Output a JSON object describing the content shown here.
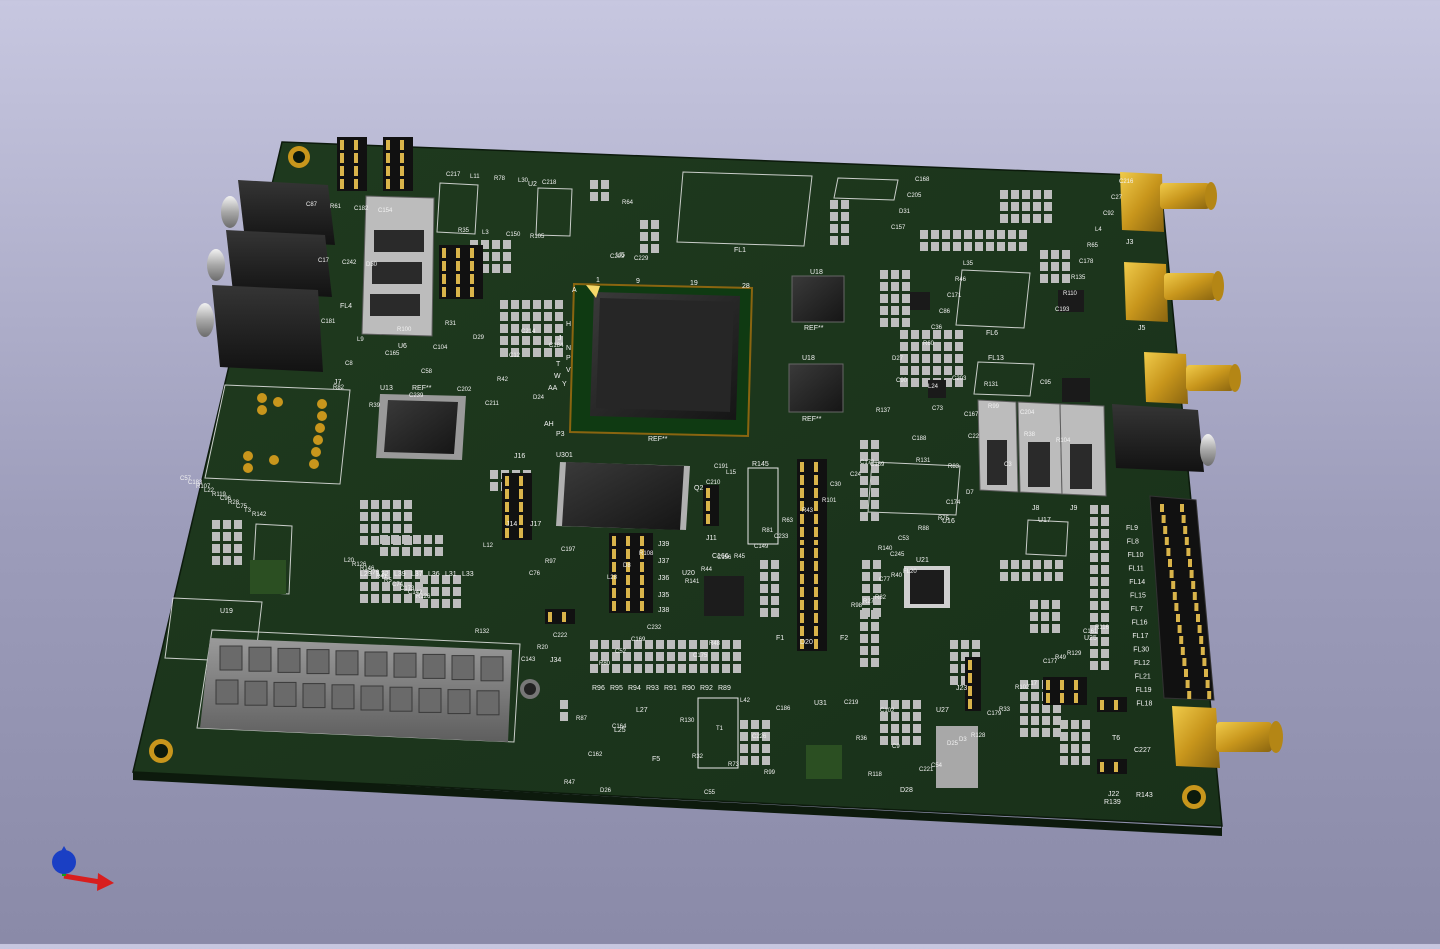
{
  "viewer": {
    "axes_indicator": "xyz-axes-icon"
  },
  "board": {
    "components": {
      "main_fpga": {
        "designator": "REF**",
        "pin_labels": [
          "1",
          "9",
          "19",
          "28",
          "A",
          "H",
          "J",
          "N",
          "P",
          "T",
          "V",
          "W",
          "Y",
          "AA",
          "AH",
          "P3"
        ]
      },
      "u18_top": {
        "designator": "U18",
        "ref": "REF**"
      },
      "u18_bottom": {
        "designator": "U18",
        "ref": "REF**"
      },
      "u13": {
        "designator": "U13",
        "ref": "REF**"
      },
      "u301": {
        "designator": "U301"
      },
      "u19": {
        "designator": "U19"
      },
      "u16": {
        "designator": "U16"
      },
      "u17": {
        "designator": "U17"
      },
      "u20": {
        "designator": "U20"
      },
      "u21": {
        "designator": "U21"
      },
      "u25": {
        "designator": "U25"
      },
      "u27": {
        "designator": "U27"
      },
      "u31": {
        "designator": "U31"
      },
      "u5": {
        "designator": "U5"
      },
      "u6": {
        "designator": "U6"
      },
      "u2": {
        "designator": "U2"
      },
      "fl1": {
        "designator": "FL1"
      },
      "fl4": {
        "designator": "FL4"
      },
      "fl6": {
        "designator": "FL6"
      },
      "fl13": {
        "designator": "FL13"
      },
      "j3": {
        "designator": "J3"
      },
      "j5": {
        "designator": "J5"
      },
      "j7": {
        "designator": "J7"
      },
      "j8": {
        "designator": "J8"
      },
      "j9": {
        "designator": "J9"
      },
      "j11": {
        "designator": "J11"
      },
      "j14": {
        "designator": "J14"
      },
      "j16": {
        "designator": "J16"
      },
      "j17": {
        "designator": "J17"
      },
      "j22": {
        "designator": "J22"
      },
      "j23": {
        "designator": "J23"
      },
      "j34": {
        "designator": "J34"
      },
      "j35": {
        "designator": "J35"
      },
      "j36": {
        "designator": "J36"
      },
      "j37": {
        "designator": "J37"
      },
      "j38": {
        "designator": "J38"
      },
      "j39": {
        "designator": "J39"
      },
      "t6": {
        "designator": "T6"
      },
      "f1": {
        "designator": "F1"
      },
      "f2": {
        "designator": "F2"
      },
      "f5": {
        "designator": "F5"
      },
      "l25": {
        "designator": "L25"
      },
      "l27": {
        "designator": "L27"
      },
      "r145": {
        "designator": "R145"
      },
      "c166": {
        "designator": "C166"
      },
      "q2": {
        "designator": "Q2"
      },
      "d20": {
        "designator": "D20"
      },
      "d28": {
        "designator": "D28"
      },
      "r139": {
        "designator": "R139"
      },
      "r143": {
        "designator": "R143"
      },
      "c227": {
        "designator": "C227"
      }
    },
    "fl_column": [
      "FL9",
      "FL8",
      "FL10",
      "FL11",
      "FL14",
      "FL15",
      "FL7",
      "FL16",
      "FL17",
      "FL30",
      "FL12",
      "FL21",
      "FL19",
      "FL18"
    ],
    "resistor_row": [
      "R96",
      "R95",
      "R94",
      "R93",
      "R91",
      "R90",
      "R92",
      "R89"
    ],
    "inductor_row": [
      "L23",
      "L32",
      "L39",
      "L37",
      "L36",
      "L31",
      "L33"
    ],
    "misc_labels": [
      "C57",
      "L12",
      "L15",
      "C77",
      "C164",
      "C165",
      "C154",
      "C157",
      "C167",
      "L20",
      "C232",
      "C245",
      "C177",
      "C186",
      "C184",
      "C218",
      "C193",
      "L24",
      "C183",
      "C197",
      "C233",
      "D25",
      "D26",
      "D29",
      "D30",
      "D31",
      "D27",
      "R126",
      "R132",
      "R75",
      "R98",
      "R99",
      "R100",
      "R105",
      "R110",
      "R104",
      "R107",
      "R108",
      "R101",
      "R102",
      "C162",
      "C181",
      "C182",
      "C205",
      "C204",
      "R146",
      "C222",
      "C210",
      "C221",
      "C226",
      "C211",
      "L30",
      "R135",
      "R131",
      "L22",
      "C156",
      "C159",
      "C161",
      "R87",
      "C239",
      "C242",
      "C168",
      "R83",
      "R76",
      "C169",
      "C149",
      "C179",
      "L42",
      "R82",
      "C150",
      "C178",
      "C188",
      "R119",
      "R97",
      "R88",
      "R40",
      "R47",
      "R42",
      "R61",
      "R60",
      "R137",
      "R41",
      "R48",
      "R43",
      "R49",
      "R73",
      "C58",
      "R78",
      "R65",
      "C95",
      "C96",
      "D8",
      "D7",
      "D3",
      "C9",
      "C8",
      "C17",
      "C36",
      "C3",
      "R5",
      "R20",
      "C24",
      "R27",
      "T1",
      "C12",
      "L3",
      "L4",
      "C22",
      "R28",
      "R44",
      "R45",
      "L17",
      "C102",
      "C104",
      "C87",
      "C86",
      "C73",
      "C74",
      "C52",
      "C53",
      "C54",
      "C55",
      "L9",
      "L11",
      "C92",
      "C90",
      "C75",
      "C76",
      "R63",
      "R116",
      "R118",
      "C214",
      "C229",
      "C171",
      "C172",
      "C173",
      "C175",
      "C174",
      "R33",
      "R32",
      "R31",
      "R35",
      "C27",
      "R38",
      "T3",
      "L28",
      "C30",
      "FL20",
      "R36",
      "R39",
      "R64",
      "R46",
      "R99",
      "C142",
      "C143",
      "C191",
      "R129",
      "R130",
      "D24",
      "C217",
      "C216",
      "C203",
      "R142",
      "R141",
      "R140",
      "R128",
      "C219",
      "C202",
      "C209",
      "L35",
      "R131",
      "R126",
      "R80",
      "R81",
      "R82"
    ]
  }
}
